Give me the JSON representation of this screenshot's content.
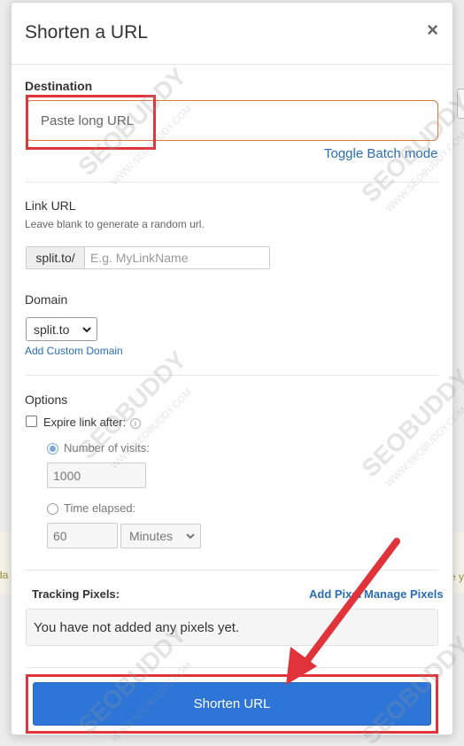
{
  "modal": {
    "title": "Shorten a URL",
    "close_label": "×"
  },
  "destination": {
    "label": "Destination",
    "placeholder": "Paste long URL",
    "toggle_batch": "Toggle Batch mode"
  },
  "link_url": {
    "label": "Link URL",
    "help": "Leave blank to generate a random url.",
    "prefix": "split.to/",
    "placeholder": "E.g. MyLinkName"
  },
  "domain": {
    "label": "Domain",
    "selected": "split.to",
    "add_custom": "Add Custom Domain"
  },
  "options": {
    "label": "Options",
    "expire_label": "Expire link after:",
    "visits_label": "Number of visits:",
    "visits_value": "1000",
    "time_label": "Time elapsed:",
    "time_value": "60",
    "time_unit": "Minutes"
  },
  "tracking": {
    "label": "Tracking Pixels:",
    "add_pixel": "Add Pixel",
    "manage_pixels": "Manage Pixels",
    "empty_text": "You have not added any pixels yet."
  },
  "submit": {
    "label": "Shorten URL"
  },
  "watermark": {
    "brand": "SEOBUDDY",
    "domain": "WWW.SEOBUDDY.COM"
  },
  "colors": {
    "primary": "#2d75d6",
    "link": "#2a6db5",
    "highlight": "#e0343a",
    "focus": "#e07a3a"
  }
}
